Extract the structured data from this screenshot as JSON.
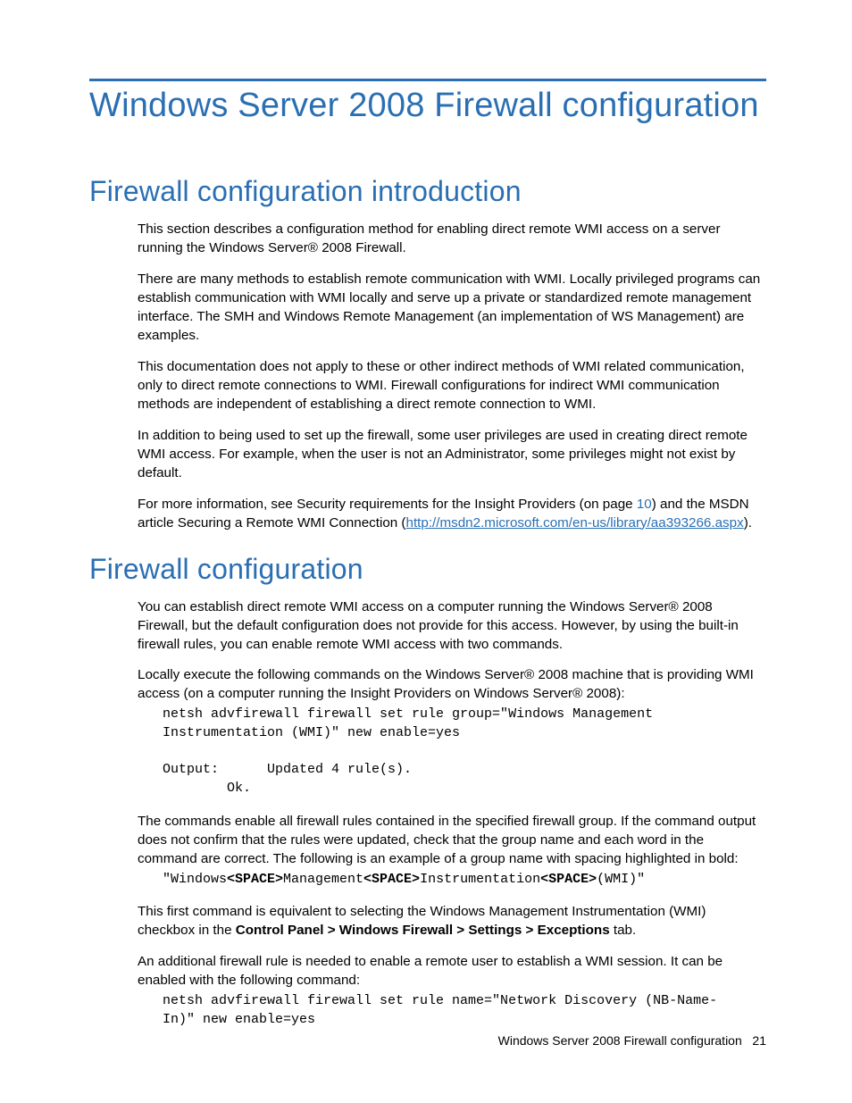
{
  "title": "Windows Server 2008 Firewall configuration",
  "sections": {
    "intro": {
      "heading": "Firewall configuration introduction",
      "p1": "This section describes a configuration method for enabling direct remote WMI access on a server running the Windows Server® 2008 Firewall.",
      "p2": "There are many methods to establish remote communication with WMI. Locally privileged programs can establish communication with WMI locally and serve up a private or standardized remote management interface. The SMH and Windows Remote Management (an implementation of WS Management) are examples.",
      "p3": "This documentation does not apply to these or other indirect methods of WMI related communication, only to direct remote connections to WMI. Firewall configurations for indirect WMI communication methods are independent of establishing a direct remote connection to WMI.",
      "p4": "In addition to being used to set up the firewall, some user privileges are used in creating direct remote WMI access. For example, when the user is not an Administrator, some privileges might not exist by default.",
      "p5_pre": "For more information, see Security requirements for the Insight Providers (on page ",
      "p5_pageref": "10",
      "p5_mid": ") and the MSDN article Securing a Remote WMI Connection (",
      "p5_link_text": "http://msdn2.microsoft.com/en-us/library/aa393266.aspx",
      "p5_post": ")."
    },
    "config": {
      "heading": "Firewall configuration",
      "p1": "You can establish direct remote WMI access on a computer running the Windows Server® 2008 Firewall, but the default configuration does not provide for this access. However, by using the built-in firewall rules, you can enable remote WMI access with two commands.",
      "p2": "Locally execute the following commands on the Windows Server® 2008 machine that is providing WMI access (on a computer running the Insight Providers on Windows Server® 2008):",
      "code1": "netsh advfirewall firewall set rule group=\"Windows Management\nInstrumentation (WMI)\" new enable=yes\n\nOutput:      Updated 4 rule(s).\n        Ok.",
      "p3": "The commands enable all firewall rules contained in the specified firewall group. If the command output does not confirm that the rules were updated, check that the group name and each word in the command are correct. The following is an example of a group name with spacing highlighted in bold:",
      "code2_seg1": "\"Windows",
      "code2_b1": "<SPACE>",
      "code2_seg2": "Management",
      "code2_b2": "<SPACE>",
      "code2_seg3": "Instrumentation",
      "code2_b3": "<SPACE>",
      "code2_seg4": "(WMI)\"",
      "p4_pre": "This first command is equivalent to selecting the Windows Management Instrumentation (WMI) checkbox in the ",
      "p4_bold": "Control Panel > Windows Firewall > Settings > Exceptions",
      "p4_post": " tab.",
      "p5": "An additional firewall rule is needed to enable a remote user to establish a WMI session. It can be enabled with the following command:",
      "code3": "netsh advfirewall firewall set rule name=\"Network Discovery (NB-Name-\nIn)\" new enable=yes"
    }
  },
  "footer": {
    "label": "Windows Server 2008 Firewall configuration",
    "page": "21"
  }
}
